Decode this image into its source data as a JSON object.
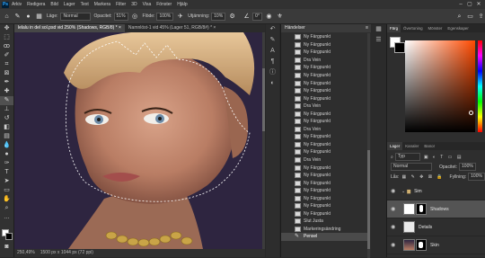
{
  "menu": {
    "logo": "Ps",
    "items": [
      "Arkiv",
      "Redigera",
      "Bild",
      "Lager",
      "Text",
      "Markera",
      "Filter",
      "3D",
      "Visa",
      "Fönster",
      "Hjälp"
    ],
    "window_buttons": [
      "–",
      "▢",
      "✕"
    ]
  },
  "options": {
    "mode_label": "Läge:",
    "mode_value": "Normal",
    "opacity_label": "Opacitet:",
    "opacity_value": "51%",
    "flow_label": "Flöde:",
    "flow_value": "100%",
    "smoothing_label": "Utjämning:",
    "smoothing_value": "10%",
    "angle_value": "0°"
  },
  "tabs": [
    "lelalu in del sol.psd vid 250% (Shadows, RGB/8) * ×",
    "Namnlöst-1 vid 45% (Lager 51, RGB/8#) * ×"
  ],
  "status": {
    "zoom": "250,49%",
    "dimensions": "1500 px x 1044 px (72 ppi)"
  },
  "history": {
    "title": "Händelser",
    "items": [
      "Ny Färgpunkt",
      "Ny Färgpunkt",
      "Ny Färgpunkt",
      "Dra Vein",
      "Ny Färgpunkt",
      "Ny Färgpunkt",
      "Ny Färgpunkt",
      "Ny Färgpunkt",
      "Ny Färgpunkt",
      "Dra Vein",
      "Ny Färgpunkt",
      "Ny Färgpunkt",
      "Dra Vein",
      "Ny Färgpunkt",
      "Ny Färgpunkt",
      "Ny Färgpunkt",
      "Dra Vein",
      "Ny Färgpunkt",
      "Ny Färgpunkt",
      "Ny Färgpunkt",
      "Ny Färgpunkt",
      "Ny Färgpunkt",
      "Ny Färgpunkt",
      "Ny Färgpunkt",
      "Slut Justa",
      "Markeringsändring",
      "Pensel"
    ],
    "current_index": 26
  },
  "color_panel": {
    "tabs": [
      "Färg",
      "Övertoning",
      "Mönster",
      "Egenskaper"
    ],
    "foreground": "#ffffff",
    "background": "#000000",
    "hue_color": "#ff4a00"
  },
  "layers_panel": {
    "tabs": [
      "Lager",
      "Kanaler",
      "Banor"
    ],
    "filter_label": "Typ",
    "blend_mode": "Normal",
    "opacity_label": "Opacitet:",
    "opacity_value": "100%",
    "lock_label": "Lås:",
    "fill_label": "Fyllning:",
    "fill_value": "100%",
    "layers": [
      {
        "name": "Sim",
        "type": "group"
      },
      {
        "name": "Shadows",
        "selected": true
      },
      {
        "name": "Details"
      },
      {
        "name": "Skin"
      }
    ]
  }
}
